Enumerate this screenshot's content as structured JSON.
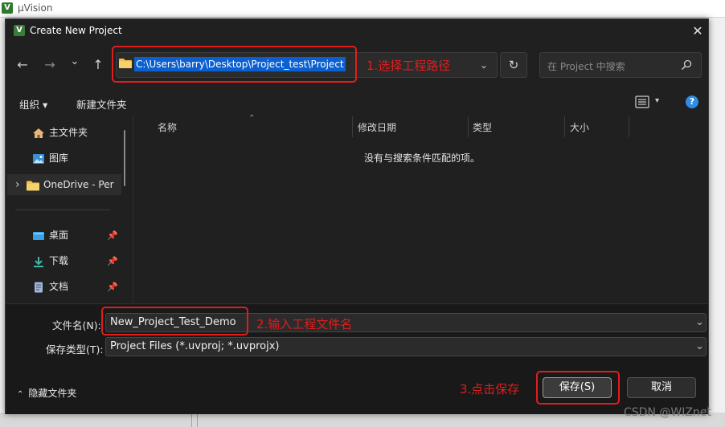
{
  "app": {
    "logo_text": "V",
    "title": "µVision"
  },
  "dialog": {
    "icon_text": "V",
    "title": "Create New Project",
    "close_glyph": "✕"
  },
  "navigation": {
    "back_glyph": "←",
    "forward_glyph": "→",
    "recent_glyph": "⌄",
    "up_glyph": "↑",
    "address_path": "C:\\Users\\barry\\Desktop\\Project_test\\Project",
    "dropdown_glyph": "⌄",
    "refresh_glyph": "↻",
    "search_placeholder": "在 Project 中搜索",
    "search_glyph": "⌕"
  },
  "annotations": {
    "step1": "1.选择工程路径",
    "step2": "2.输入工程文件名",
    "step3": "3.点击保存"
  },
  "toolbar": {
    "organize_label": "组织 ▾",
    "new_folder_label": "新建文件夹",
    "view_dropdown_glyph": "▾",
    "help_glyph": "?"
  },
  "nav_pane": {
    "items": [
      {
        "label": "主文件夹"
      },
      {
        "label": "图库"
      },
      {
        "label": "OneDrive - Per",
        "expander": "›"
      },
      {
        "label": "桌面",
        "pin": "📌"
      },
      {
        "label": "下载",
        "pin": "📌"
      },
      {
        "label": "文档",
        "pin": "📌"
      }
    ]
  },
  "file_list": {
    "sort_glyph": "⌃",
    "columns": [
      "名称",
      "修改日期",
      "类型",
      "大小"
    ],
    "empty_message": "没有与搜索条件匹配的项。"
  },
  "form": {
    "filename_label": "文件名(N):",
    "filename_value": "New_Project_Test_Demo",
    "filetype_label": "保存类型(T):",
    "filetype_value": "Project Files (*.uvproj; *.uvprojx)",
    "combo_glyph": "⌄",
    "hide_folders_label": "隐藏文件夹",
    "hide_folders_glyph": "⌃",
    "save_label": "保存(S)",
    "cancel_label": "取消"
  },
  "watermark": "CSDN @WIZnet",
  "colors": {
    "annotation_red": "#e01d1d",
    "selection_blue": "#0a5fd1",
    "folder_yellow": "#f3c24a"
  }
}
